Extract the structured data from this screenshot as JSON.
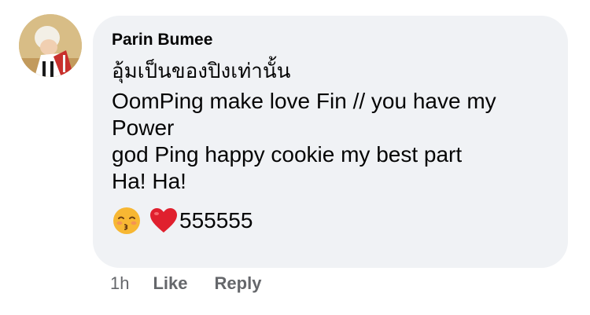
{
  "comment": {
    "author": "Parin Bumee",
    "text_lines": [
      "อุ้มเป็นของปิงเท่านั้น",
      "OomPing make love Fin // you have my",
      "Power",
      "god Ping happy cookie my best part",
      "Ha! Ha!"
    ],
    "emojis": [
      "kissing-face-emoji",
      "red-heart-emoji"
    ],
    "emoji_trailing_text": "555555",
    "timestamp": "1h",
    "actions": {
      "like": "Like",
      "reply": "Reply"
    }
  },
  "colors": {
    "bubble_background": "#f0f2f5",
    "primary_text": "#050505",
    "secondary_text": "#65676b",
    "heart": "#e0202e",
    "emoji_face": "#f7b733"
  }
}
